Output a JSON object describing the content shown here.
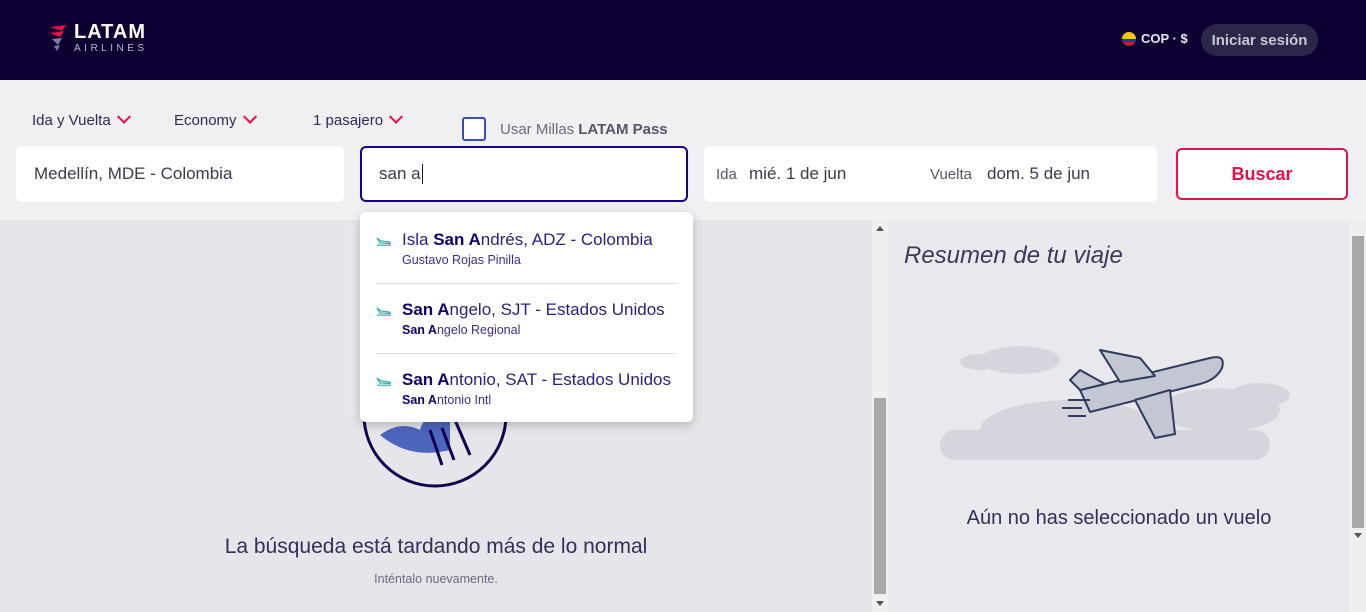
{
  "header": {
    "logo_text": "LATAM",
    "logo_subtext": "AIRLINES",
    "currency": "COP · $",
    "login_label": "Iniciar sesión"
  },
  "search": {
    "trip_type": "Ida y Vuelta",
    "cabin": "Economy",
    "passengers": "1 pasajero",
    "millas_label": "Usar Millas",
    "millas_brand": "LATAM Pass",
    "origin": "Medellín, MDE - Colombia",
    "destination_value": "san a",
    "ida_label": "Ida",
    "ida_value": "mié. 1 de jun",
    "vuelta_label": "Vuelta",
    "vuelta_value": "dom. 5 de jun",
    "search_button": "Buscar"
  },
  "suggestions": [
    {
      "prefix": "Isla ",
      "highlight": "San A",
      "rest": "ndrés, ADZ - Colombia",
      "sub_highlight": "",
      "sub_rest": "Gustavo Rojas Pinilla"
    },
    {
      "prefix": "",
      "highlight": "San A",
      "rest": "ngelo, SJT - Estados Unidos",
      "sub_highlight": "San A",
      "sub_rest": "ngelo Regional"
    },
    {
      "prefix": "",
      "highlight": "San A",
      "rest": "ntonio, SAT - Estados Unidos",
      "sub_highlight": "San A",
      "sub_rest": "ntonio Intl"
    }
  ],
  "main": {
    "error_title": "La búsqueda está tardando más de lo normal",
    "error_subtitle": "Inténtalo nuevamente."
  },
  "summary": {
    "title": "Resumen de tu viaje",
    "empty_message": "Aún no has seleccionado un vuelo"
  },
  "colors": {
    "header_bg": "#0e0030",
    "accent": "#e3124b",
    "brand_blue": "#1b0088"
  }
}
